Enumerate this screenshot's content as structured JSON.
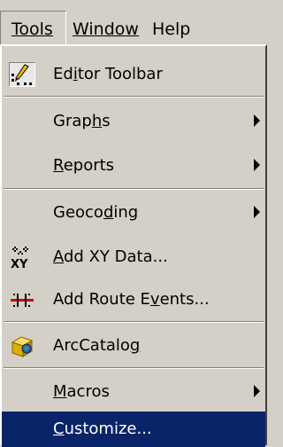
{
  "menubar": {
    "tools_label": "Tools",
    "window_label": "Window",
    "help_label": "Help"
  },
  "menu": {
    "items": [
      {
        "label_pre": "Ed",
        "label_u": "i",
        "label_post": "tor Toolbar",
        "icon": "pencil-icon"
      },
      {
        "label_pre": "Grap",
        "label_u": "h",
        "label_post": "s",
        "submenu": true
      },
      {
        "label_pre": "",
        "label_u": "R",
        "label_post": "eports",
        "submenu": true
      },
      {
        "label_pre": "Geoco",
        "label_u": "d",
        "label_post": "ing",
        "submenu": true
      },
      {
        "label_pre": "",
        "label_u": "A",
        "label_post": "dd XY Data...",
        "icon": "xy-data-icon"
      },
      {
        "label_pre": "Add Route E",
        "label_u": "v",
        "label_post": "ents...",
        "icon": "route-events-icon"
      },
      {
        "label_pre": "ArcCatalo",
        "label_u": "g",
        "label_post": "",
        "icon": "arccatalog-icon"
      },
      {
        "label_pre": "",
        "label_u": "M",
        "label_post": "acros",
        "submenu": true
      },
      {
        "label_pre": "",
        "label_u": "C",
        "label_post": "ustomize...",
        "selected": true
      }
    ]
  },
  "colors": {
    "menu_bg": "#d4d0c8",
    "highlight": "#0a246a",
    "highlight_text": "#ffffff"
  }
}
